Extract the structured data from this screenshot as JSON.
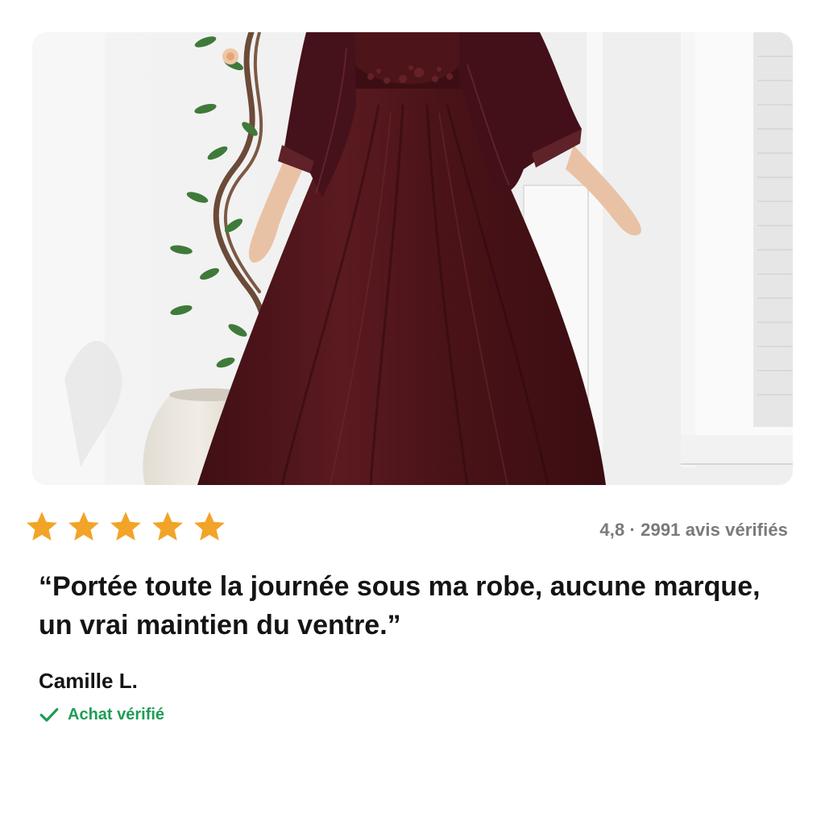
{
  "review_card": {
    "photo": {
      "icon": "product-photo-burgundy-dress"
    },
    "rating": {
      "stars": 5,
      "star_color": "#f2a428",
      "summary": "4,8 · 2991 avis vérifiés"
    },
    "quote": "“Portée toute la journée sous ma robe, aucune marque, un vrai maintien du ventre.”",
    "author": "Camille L.",
    "verified": {
      "icon": "checkmark-icon",
      "label": "Achat vérifié",
      "color": "#1f9d55"
    }
  }
}
